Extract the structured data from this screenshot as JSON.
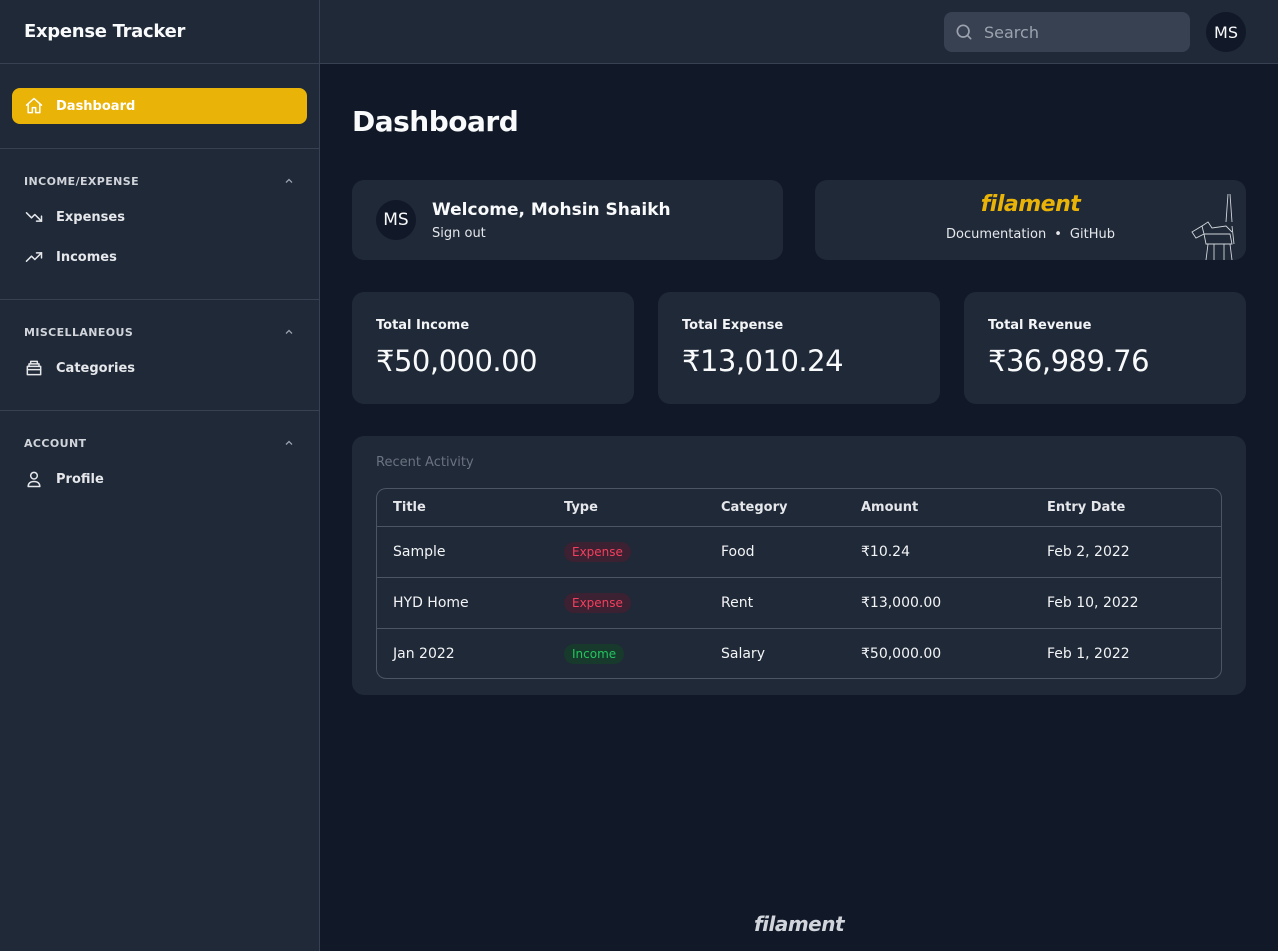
{
  "app": {
    "title": "Expense Tracker"
  },
  "colors": {
    "accent": "#eab308",
    "expense": "#f43f5e",
    "income": "#22c55e",
    "background": "#111827",
    "panel": "#1f2937"
  },
  "sidebar": {
    "active": {
      "label": "Dashboard",
      "icon": "home-icon"
    },
    "groups": [
      {
        "label": "INCOME/EXPENSE",
        "items": [
          {
            "label": "Expenses",
            "icon": "trending-down-icon"
          },
          {
            "label": "Incomes",
            "icon": "trending-up-icon"
          }
        ]
      },
      {
        "label": "MISCELLANEOUS",
        "items": [
          {
            "label": "Categories",
            "icon": "archive-icon"
          }
        ]
      },
      {
        "label": "ACCOUNT",
        "items": [
          {
            "label": "Profile",
            "icon": "user-icon"
          }
        ]
      }
    ]
  },
  "topbar": {
    "search_placeholder": "Search",
    "avatar_initials": "MS"
  },
  "page": {
    "title": "Dashboard"
  },
  "welcome": {
    "initials": "MS",
    "greeting": "Welcome, Mohsin Shaikh",
    "sign_out": "Sign out"
  },
  "filament": {
    "logo": "filament",
    "docs": "Documentation",
    "separator": "•",
    "github": "GitHub"
  },
  "stats": [
    {
      "label": "Total Income",
      "value": "₹50,000.00"
    },
    {
      "label": "Total Expense",
      "value": "₹13,010.24"
    },
    {
      "label": "Total Revenue",
      "value": "₹36,989.76"
    }
  ],
  "activity": {
    "heading": "Recent Activity",
    "columns": [
      "Title",
      "Type",
      "Category",
      "Amount",
      "Entry Date"
    ],
    "rows": [
      {
        "title": "Sample",
        "type": "Expense",
        "category": "Food",
        "amount": "₹10.24",
        "date": "Feb 2, 2022"
      },
      {
        "title": "HYD Home",
        "type": "Expense",
        "category": "Rent",
        "amount": "₹13,000.00",
        "date": "Feb 10, 2022"
      },
      {
        "title": "Jan 2022",
        "type": "Income",
        "category": "Salary",
        "amount": "₹50,000.00",
        "date": "Feb 1, 2022"
      }
    ]
  },
  "footer": {
    "logo": "filament"
  }
}
